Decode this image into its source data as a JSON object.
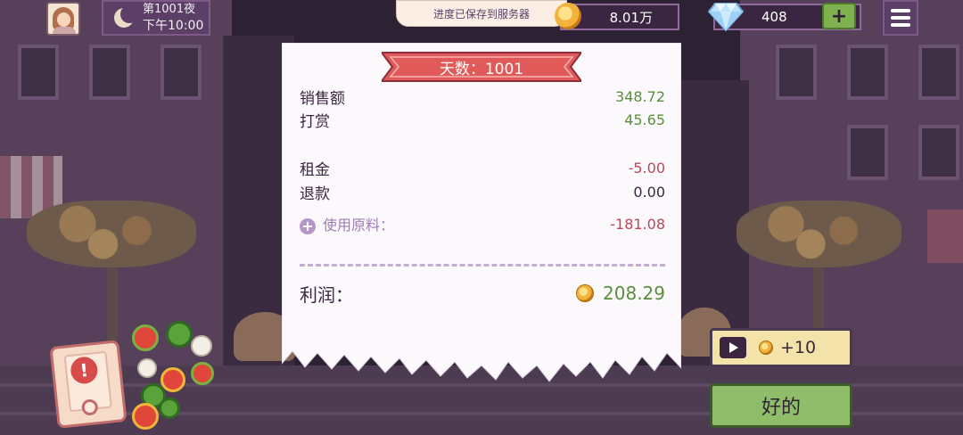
{
  "hud": {
    "night_label": "第1001夜",
    "time_label": "下午10:00",
    "save_toast": "进度已保存到服务器",
    "coins": "8.01万",
    "gems": "408",
    "add_label": "+"
  },
  "receipt": {
    "day_title": "天数：1001",
    "rows": [
      {
        "label": "销售额",
        "value": "348.72"
      },
      {
        "label": "打赏",
        "value": "45.65"
      },
      {
        "label": "租金",
        "value": "-5.00"
      },
      {
        "label": "退款",
        "value": "0.00"
      },
      {
        "label": "使用原料：",
        "value": "-181.08"
      }
    ],
    "profit_label": "利润：",
    "profit_value": "208.29"
  },
  "buttons": {
    "ad_reward": "+10",
    "ok": "好的"
  },
  "colors": {
    "positive": "#5a8f3d",
    "negative": "#b8475a",
    "ribbon": "#e05a5a",
    "ok_button": "#8fbd6a",
    "ad_button": "#f3e3a8"
  },
  "icons": [
    "moon-icon",
    "coin-icon",
    "gem-icon",
    "menu-icon",
    "add-circle-icon",
    "play-icon",
    "alert-icon"
  ]
}
